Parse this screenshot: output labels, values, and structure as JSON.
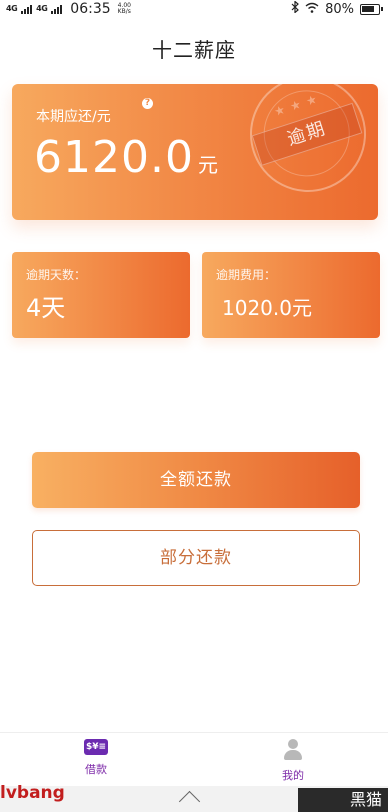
{
  "status_bar": {
    "signal1": "4G",
    "signal2": "4G",
    "time": "06:35",
    "net_speed_value": "4.00",
    "net_speed_unit": "KB/s",
    "battery": "80%"
  },
  "header": {
    "title": "十二薪座"
  },
  "main_card": {
    "label": "本期应还/元",
    "help_glyph": "?",
    "amount": "6120.0",
    "unit": "元",
    "stamp_text": "逾期"
  },
  "overdue_days": {
    "label": "逾期天数：",
    "value": "4天"
  },
  "overdue_fee": {
    "label": "逾期费用：",
    "value": "1020.0元"
  },
  "buttons": {
    "full_repay": "全额还款",
    "partial_repay": "部分还款"
  },
  "bottom_nav": {
    "items": [
      {
        "label": "借款",
        "icon": "loan-icon",
        "icon_text": "$¥≡",
        "active": true
      },
      {
        "label": "我的",
        "icon": "user-icon",
        "active": false
      }
    ]
  },
  "watermark": {
    "left": "lvbang",
    "right": "黑猫"
  },
  "colors": {
    "accent_start": "#f7a95e",
    "accent_end": "#ec6a2e",
    "nav_active": "#7d2aa8",
    "outline_button": "#c86e3a"
  }
}
